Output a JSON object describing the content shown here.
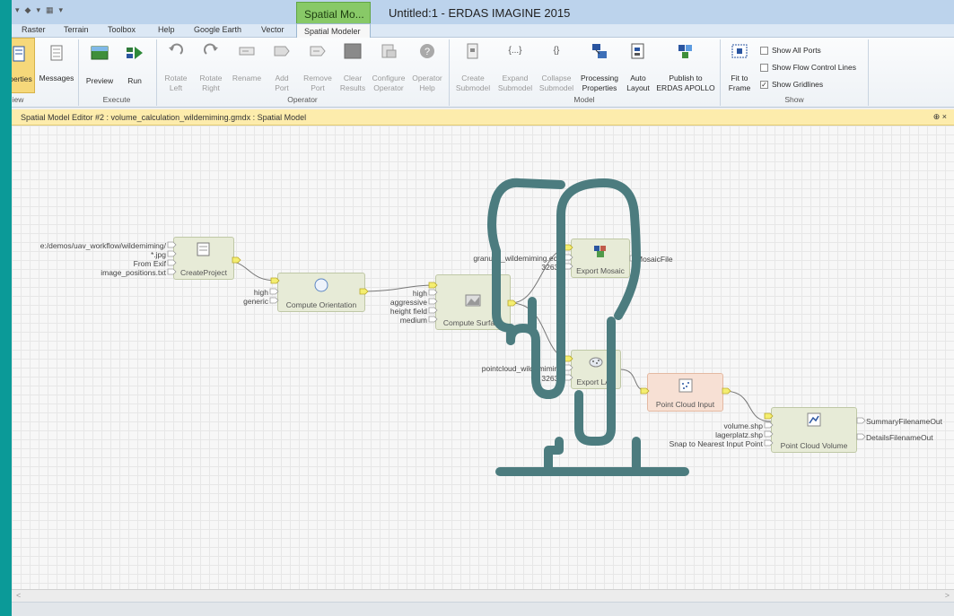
{
  "window": {
    "title": "Untitled:1 - ERDAS IMAGINE 2015",
    "context_tab": "Spatial Mo..."
  },
  "ribbon_tabs": [
    "Raster",
    "Terrain",
    "Toolbox",
    "Help",
    "Google Earth",
    "Vector"
  ],
  "active_tab": "Spatial Modeler",
  "groups": {
    "view": "iew",
    "execute": "Execute",
    "operator": "Operator",
    "model": "Model",
    "show": "Show"
  },
  "buttons": {
    "properties": "perties",
    "messages": "Messages",
    "preview": "Preview",
    "run": "Run",
    "rotate_left": [
      "Rotate",
      "Left"
    ],
    "rotate_right": [
      "Rotate",
      "Right"
    ],
    "rename": "Rename",
    "add_port": [
      "Add",
      "Port"
    ],
    "remove_port": [
      "Remove",
      "Port"
    ],
    "clear_results": [
      "Clear",
      "Results"
    ],
    "configure_operator": [
      "Configure",
      "Operator"
    ],
    "operator_help": [
      "Operator",
      "Help"
    ],
    "create_submodel": [
      "Create",
      "Submodel"
    ],
    "expand_submodel": [
      "Expand",
      "Submodel"
    ],
    "collapse_submodel": [
      "Collapse",
      "Submodel"
    ],
    "processing_properties": [
      "Processing",
      "Properties"
    ],
    "auto_layout": [
      "Auto",
      "Layout"
    ],
    "publish_apollo": [
      "Publish to",
      "ERDAS APOLLO"
    ],
    "fit_to_frame": [
      "Fit to",
      "Frame"
    ],
    "expand_icon_text": "{...}",
    "collapse_icon_text": "{}"
  },
  "show_options": [
    {
      "label": "Show All Ports",
      "checked": false
    },
    {
      "label": "Show Flow Control Lines",
      "checked": false
    },
    {
      "label": "Show Gridlines",
      "checked": true
    }
  ],
  "editor": {
    "header": "Spatial Model Editor #2 : volume_calculation_wildemiming.gmdx : Spatial Model",
    "controls": "⊕  ×"
  },
  "nodes": {
    "create_project": {
      "title": "CreateProject",
      "inputs": [
        "e:/demos/uav_workflow/wildemiming/",
        "*.jpg",
        "From Exif",
        "image_positions.txt"
      ]
    },
    "compute_orientation": {
      "title": "Compute Orientation",
      "inputs": [
        "high",
        "generic"
      ]
    },
    "compute_surface": {
      "title": "Compute Surface",
      "inputs": [
        "high",
        "aggressive",
        "height field",
        "medium"
      ]
    },
    "export_mosaic": {
      "title": "Export Mosaic",
      "inputs": [
        "granulat_wildemiming.ecw",
        "32632"
      ],
      "output": "MosaicFile"
    },
    "export_las": {
      "title": "Export LAS",
      "inputs": [
        "pointcloud_wildemiming",
        "32632"
      ]
    },
    "point_cloud_input": {
      "title": "Point Cloud Input"
    },
    "point_cloud_volume": {
      "title": "Point Cloud Volume",
      "inputs": [
        "volume.shp",
        "lagerplatz.shp",
        "Snap to Nearest Input Point"
      ],
      "outputs": [
        "SummaryFilenameOut",
        "DetailsFilenameOut"
      ]
    }
  },
  "colors": {
    "accent_green": "#88c967",
    "node_fill": "#e7ebd7",
    "node_peach": "#f7e0d4",
    "overlay_hand": "#4c7c7f",
    "frame_teal": "#0b9a98"
  },
  "scrollbar": {
    "left_arrow": "<",
    "right_arrow": ">"
  }
}
